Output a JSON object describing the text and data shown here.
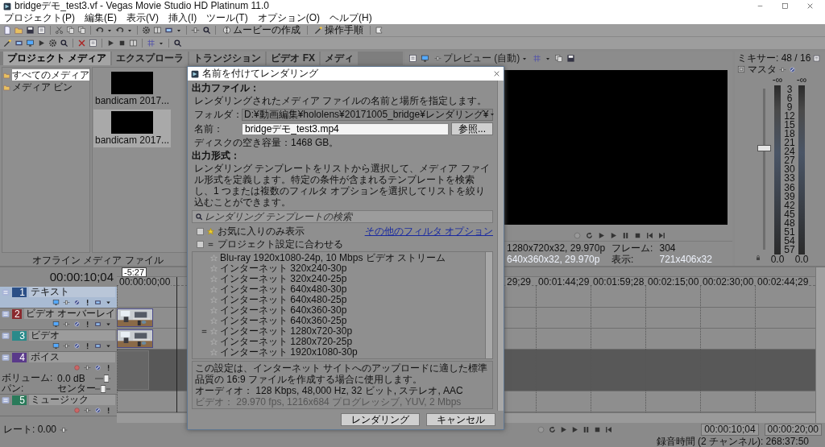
{
  "window": {
    "title": "bridgeデモ_test3.vf - Vegas Movie Studio HD Platinum 11.0"
  },
  "menu": [
    "プロジェクト(P)",
    "編集(E)",
    "表示(V)",
    "挿入(I)",
    "ツール(T)",
    "オプション(O)",
    "ヘルプ(H)"
  ],
  "toolbar": {
    "make_movie": "ムービーの作成",
    "guide": "操作手順"
  },
  "media": {
    "tree": [
      {
        "label": "すべてのメディア",
        "selected": true
      },
      {
        "label": "メディア ビン",
        "selected": false
      }
    ],
    "clips": [
      {
        "label": "bandicam 2017...",
        "selected": false
      },
      {
        "label": "bandicam 2017...",
        "selected": true
      }
    ],
    "status": "オフライン メディア ファイル"
  },
  "dock_tabs": [
    {
      "label": "プロジェクト メディア",
      "selected": true
    },
    {
      "label": "エクスプローラ",
      "selected": false
    },
    {
      "label": "トランジション",
      "selected": false
    },
    {
      "label": "ビデオ FX",
      "selected": false
    },
    {
      "label": "メディ",
      "selected": false
    }
  ],
  "preview": {
    "mode": "プレビュー (自動)",
    "project_info": "1280x720x32, 29.970p",
    "preview_info": "640x360x32, 29.970p",
    "frame_label": "フレーム:",
    "frame": "304",
    "display_label": "表示:",
    "display": "721x406x32"
  },
  "mixer": {
    "title": "ミキサー: 48 / 16",
    "bus": "マスタ",
    "peaks": [
      "-∞",
      "-∞"
    ],
    "scale": [
      "3",
      "6",
      "9",
      "12",
      "15",
      "18",
      "21",
      "24",
      "27",
      "30",
      "33",
      "36",
      "39",
      "42",
      "45",
      "48",
      "51",
      "54",
      "57"
    ],
    "readings": [
      "0.0",
      "0.0"
    ],
    "fader": {
      "level": 0.63
    }
  },
  "timeline": {
    "time": "00:00:10;04",
    "marker": "-5:27",
    "ruler": [
      "00:00:00;00",
      "29;29",
      "00:01:44;29",
      "00:01:59;28",
      "00:02:15;00",
      "00:02:30;00",
      "00:02:44;29"
    ],
    "tracks": [
      {
        "number": "1",
        "name": "テキスト",
        "kind": "video",
        "color": "#2b4f86",
        "selected": true
      },
      {
        "number": "2",
        "name": "ビデオ オーバーレイ",
        "kind": "video",
        "color": "#8a2a2e",
        "selected": false
      },
      {
        "number": "3",
        "name": "ビデオ",
        "kind": "video",
        "color": "#2a8a8a",
        "selected": false
      },
      {
        "number": "4",
        "name": "ボイス",
        "kind": "audio",
        "color": "#5a3a8a",
        "selected": false,
        "clip": {
          "kind": "audio"
        },
        "volume": {
          "label": "ボリューム:",
          "value": "0.0 dB",
          "level": 0.75
        },
        "pan": {
          "label": "パン:",
          "value": "センター",
          "level": 0.5
        }
      },
      {
        "number": "5",
        "name": "ミュージック",
        "kind": "audio",
        "color": "#2a7a5a",
        "selected": false
      }
    ]
  },
  "transport": {
    "rate_label": "レート: 0.00",
    "cursor": "00:00:10;04",
    "length": "00:00:20;00",
    "status": "録音時間 (2 チャンネル): 268:37:50"
  },
  "dialog": {
    "title": "名前を付けてレンダリング",
    "output_file": {
      "heading": "出力ファイル：",
      "description": "レンダリングされたメディア ファイルの名前と場所を指定します。",
      "folder_label": "フォルダ：",
      "folder": "D:¥動画編集¥hololens¥20171005_bridge¥レンダリング¥",
      "name_label": "名前：",
      "name": "bridgeデモ_test3.mp4",
      "browse": "参照...",
      "disk_space": "ディスクの空き容量：1468 GB。"
    },
    "output_format": {
      "heading": "出力形式：",
      "description": "レンダリング テンプレートをリストから選択して、メディア ファイル形式を定義します。特定の条件が含まれるテンプレートを検索し、1 つまたは複数のフィルタ オプションを選択してリストを絞り込むことができます。",
      "search_placeholder": "レンダリング テンプレートの検索",
      "filters": [
        {
          "kind": "favorite",
          "label": "お気に入りのみ表示",
          "checked": false
        },
        {
          "kind": "project",
          "label": "プロジェクト設定に合わせる",
          "checked": false
        }
      ],
      "more_filters": "その他のフィルタ オプション",
      "templates": [
        {
          "label": "Blu-ray 1920x1080-24p, 10 Mbps ビデオ ストリーム",
          "project_match": false
        },
        {
          "label": "インターネット 320x240-30p",
          "project_match": false
        },
        {
          "label": "インターネット 320x240-25p",
          "project_match": false
        },
        {
          "label": "インターネット 640x480-30p",
          "project_match": false
        },
        {
          "label": "インターネット 640x480-25p",
          "project_match": false
        },
        {
          "label": "インターネット 640x360-30p",
          "project_match": false
        },
        {
          "label": "インターネット 640x360-25p",
          "project_match": false
        },
        {
          "label": "インターネット 1280x720-30p",
          "project_match": true
        },
        {
          "label": "インターネット 1280x720-25p",
          "project_match": false
        },
        {
          "label": "インターネット 1920x1080-30p",
          "project_match": false
        }
      ],
      "summary": "この設定は、インターネット サイトへのアップロードに適した標準品質の 16:9 ファイルを作成する場合に使用します。",
      "audio": "オーディオ： 128 Kbps, 48,000 Hz, 32 ビット, ステレオ, AAC",
      "video": "ビデオ： 29.970 fps, 1216x684 プログレッシブ, YUV, 2 Mbps"
    },
    "buttons": [
      "レンダリング",
      "キャンセル"
    ]
  }
}
